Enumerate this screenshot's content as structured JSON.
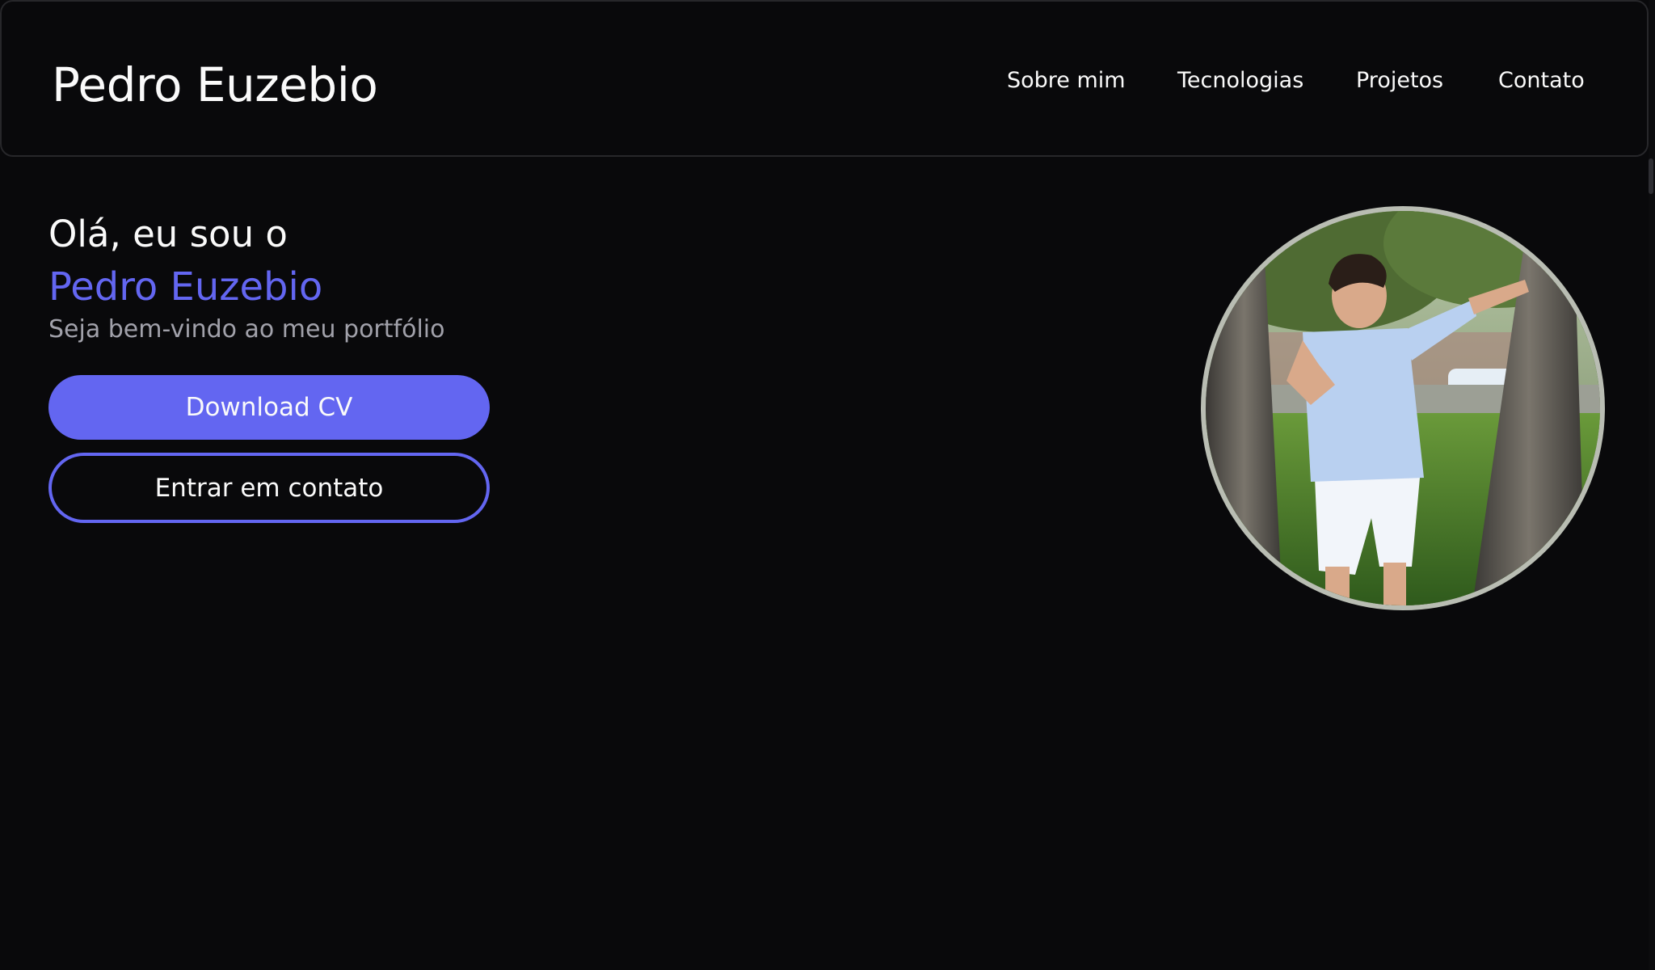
{
  "header": {
    "logo": "Pedro Euzebio",
    "nav": [
      {
        "label": "Sobre mim"
      },
      {
        "label": "Tecnologias"
      },
      {
        "label": "Projetos"
      },
      {
        "label": "Contato"
      }
    ]
  },
  "hero": {
    "greeting": "Olá, eu sou o",
    "name": "Pedro Euzebio",
    "subtitle": "Seja bem-vindo ao meu portfólio",
    "primary_button": "Download CV",
    "secondary_button": "Entrar em contato"
  },
  "colors": {
    "background": "#09090b",
    "accent": "#6366f1",
    "muted_text": "#a1a1aa",
    "text": "#fafafa",
    "border": "#27272a"
  }
}
